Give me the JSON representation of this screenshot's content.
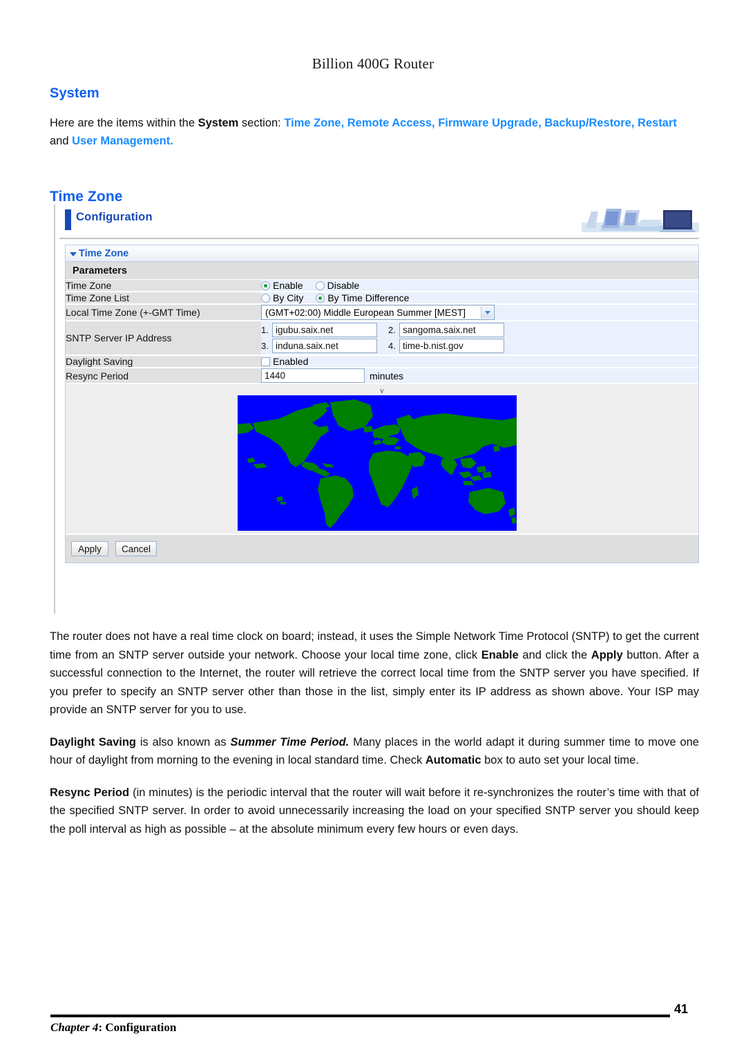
{
  "running_head": "Billion 400G Router",
  "section": {
    "title": "System",
    "intro_prefix": "Here are the items within the ",
    "intro_bold": "System",
    "intro_mid": " section: ",
    "links": "Time Zone, Remote Access, Firmware Upgrade, Backup/Restore,",
    "links2": "Restart",
    "intro_and": " and ",
    "links3": "User Management.",
    "subtitle": "Time Zone"
  },
  "screenshot": {
    "header_label": "Configuration",
    "deco_icon": "laptop-monitor-illustration",
    "panel_title": "Time Zone",
    "params_header": "Parameters",
    "collapse_icon": "triangle-down-icon",
    "map_caret": "v",
    "map_icon": "world-map",
    "map_colors": {
      "ocean": "#0000ff",
      "land": "#008000"
    },
    "rows": [
      {
        "label": "Time Zone",
        "type": "radio",
        "options": [
          {
            "text": "Enable",
            "selected": true
          },
          {
            "text": "Disable",
            "selected": false
          }
        ]
      },
      {
        "label": "Time Zone List",
        "type": "radio",
        "options": [
          {
            "text": "By City",
            "selected": false
          },
          {
            "text": "By Time Difference",
            "selected": true
          }
        ]
      },
      {
        "label": "Local Time Zone (+-GMT Time)",
        "type": "select",
        "value": "(GMT+02:00) Middle European Summer [MEST]"
      },
      {
        "label": "SNTP Server IP Address",
        "type": "sntp",
        "servers": [
          {
            "num": "1.",
            "value": "igubu.saix.net"
          },
          {
            "num": "2.",
            "value": "sangoma.saix.net"
          },
          {
            "num": "3.",
            "value": "induna.saix.net"
          },
          {
            "num": "4.",
            "value": "time-b.nist.gov"
          }
        ]
      },
      {
        "label": "Daylight Saving",
        "type": "checkbox",
        "checkbox_label": "Enabled",
        "checked": false
      },
      {
        "label": "Resync Period",
        "type": "text",
        "value": "1440",
        "unit": "minutes"
      }
    ],
    "buttons": [
      {
        "label": "Apply"
      },
      {
        "label": "Cancel"
      }
    ]
  },
  "prose": {
    "p1_a": "The router does not have a real time clock on board; instead, it uses the Simple Network Time Protocol (SNTP) to get the current time from an SNTP server outside your network. Choose your local time zone, click ",
    "p1_b1": "Enable",
    "p1_b": " and click the ",
    "p1_b2": "Apply",
    "p1_c": " button. After a successful connection to the Internet, the router will retrieve the correct local time from the SNTP server you have specified. If you prefer to specify an SNTP server other than those in the list, simply enter its IP address as shown above. Your ISP may provide an SNTP server for you to use.",
    "p2_b1": "Daylight Saving",
    "p2_a": " is also known as ",
    "p2_i": "Summer Time Period.",
    "p2_b": " Many places in the world adapt it during summer time to move one hour of daylight from morning to the evening in local standard time. Check ",
    "p2_b2": "Automatic",
    "p2_c": " box to auto set your local time.",
    "p3_b1": "Resync Period",
    "p3_a": " (in minutes) is the periodic interval that the router will wait before it re-synchronizes the router’s time with that of the specified SNTP server. In order to avoid unnecessarily increasing the load on your specified SNTP server you should keep the poll interval as high as possible – at the absolute minimum every few hours or even days."
  },
  "footer": {
    "chapter_bold": "Chapter 4",
    "chapter_rest": ": Configuration",
    "page_number": "41"
  }
}
